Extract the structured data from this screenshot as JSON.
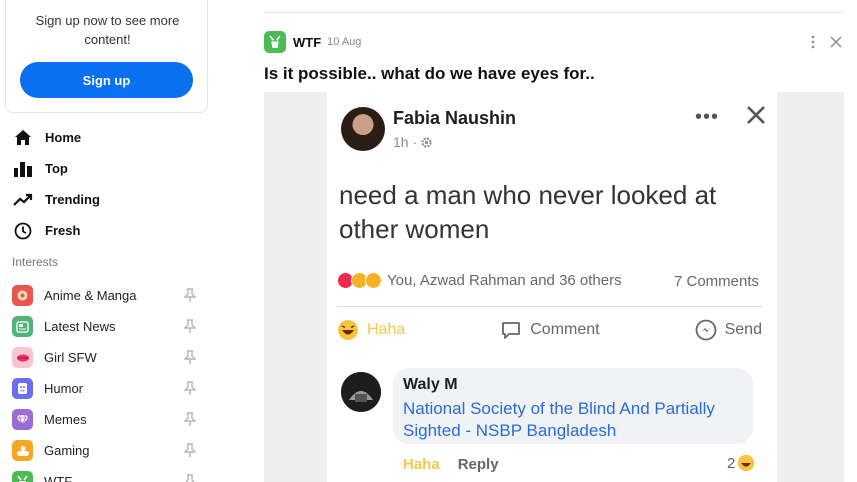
{
  "sidebar": {
    "signup_text": "Sign up now to see more content!",
    "signup_button": "Sign up",
    "nav": [
      {
        "label": "Home",
        "icon": "home-icon"
      },
      {
        "label": "Top",
        "icon": "bar-chart-icon"
      },
      {
        "label": "Trending",
        "icon": "trending-icon"
      },
      {
        "label": "Fresh",
        "icon": "clock-icon"
      }
    ],
    "interests_title": "Interests",
    "interests": [
      {
        "label": "Anime & Manga",
        "color": "#e8574f"
      },
      {
        "label": "Latest News",
        "color": "#53b37a"
      },
      {
        "label": "Girl SFW",
        "color": "#f57aa0"
      },
      {
        "label": "Humor",
        "color": "#6c6ef0"
      },
      {
        "label": "Memes",
        "color": "#9b6bd8"
      },
      {
        "label": "Gaming",
        "color": "#f5a623"
      },
      {
        "label": "WTF",
        "color": "#4cbb56"
      }
    ]
  },
  "post": {
    "section": "WTF",
    "date": "10 Aug",
    "title": "Is it possible.. what do we have eyes for..",
    "embed": {
      "author": "Fabia Naushin",
      "time": "1h ·",
      "text": "need a man who never looked at other women",
      "reactors": "You, Azwad Rahman and 36 others",
      "comments_count": "7 Comments",
      "actions": {
        "haha": "Haha",
        "comment": "Comment",
        "send": "Send"
      },
      "comment": {
        "author": "Waly M",
        "text": "National Society of the Blind And Partially Sighted - NSBP Bangladesh",
        "haha": "Haha",
        "reply": "Reply",
        "reaction_count": "2"
      }
    }
  }
}
